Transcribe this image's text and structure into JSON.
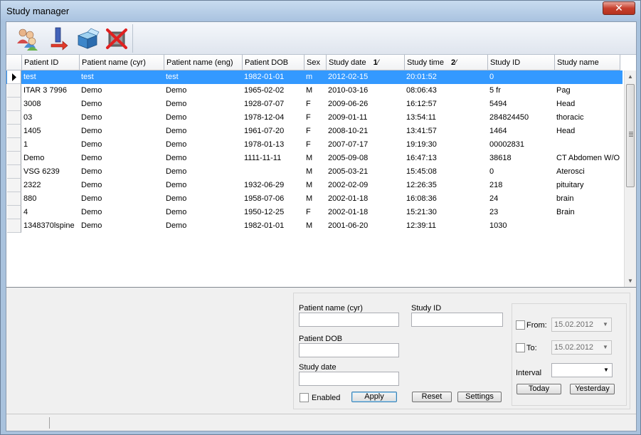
{
  "window": {
    "title": "Study manager",
    "close_label": "✕"
  },
  "toolbar": {
    "icons": [
      "patients-icon",
      "import-icon",
      "open-box-icon",
      "delete-icon"
    ]
  },
  "grid": {
    "columns": [
      "Patient ID",
      "Patient name (cyr)",
      "Patient name (eng)",
      "Patient DOB",
      "Sex",
      "Study date",
      "Study time",
      "Study ID",
      "Study name"
    ],
    "sort_markers": {
      "study_date": "1",
      "study_time": "2"
    },
    "selected_row": 0,
    "rows": [
      [
        "test",
        "test",
        "test",
        "1982-01-01",
        "m",
        "2012-02-15",
        "20:01:52",
        "0",
        ""
      ],
      [
        "ITAR 3    7996",
        "Demo",
        "Demo",
        "1965-02-02",
        "M",
        "2010-03-16",
        "08:06:43",
        "5 fr",
        "Pag"
      ],
      [
        "3008",
        "Demo",
        "Demo",
        "1928-07-07",
        "F",
        "2009-06-26",
        "16:12:57",
        "5494",
        "Head"
      ],
      [
        "03",
        "Demo",
        "Demo",
        "1978-12-04",
        "F",
        "2009-01-11",
        "13:54:11",
        "284824450",
        "thoracic"
      ],
      [
        "1405",
        "Demo",
        "Demo",
        "1961-07-20",
        "F",
        "2008-10-21",
        "13:41:57",
        "1464",
        "Head"
      ],
      [
        "1",
        "Demo",
        "Demo",
        "1978-01-13",
        "F",
        "2007-07-17",
        "19:19:30",
        "00002831",
        ""
      ],
      [
        "Demo",
        "Demo",
        "Demo",
        "1111-11-11",
        "M",
        "2005-09-08",
        "16:47:13",
        "38618",
        "CT Abdomen W/O c"
      ],
      [
        "VSG    6239",
        "Demo",
        "Demo",
        "",
        "M",
        "2005-03-21",
        "15:45:08",
        "0",
        "Aterosci"
      ],
      [
        "2322",
        "Demo",
        "Demo",
        "1932-06-29",
        "M",
        "2002-02-09",
        "12:26:35",
        "218",
        "pituitary"
      ],
      [
        "880",
        "Demo",
        "Demo",
        "1958-07-06",
        "M",
        "2002-01-18",
        "16:08:36",
        "24",
        "brain"
      ],
      [
        "4",
        "Demo",
        "Demo",
        "1950-12-25",
        "F",
        "2002-01-18",
        "15:21:30",
        "23",
        "Brain"
      ],
      [
        "1348370lspine",
        "Demo",
        "Demo",
        "1982-01-01",
        "M",
        "2001-06-20",
        "12:39:11",
        "1030",
        ""
      ]
    ]
  },
  "filter": {
    "patient_name_label": "Patient name (cyr)",
    "patient_name_value": "",
    "study_id_label": "Study ID",
    "study_id_value": "",
    "patient_dob_label": "Patient DOB",
    "patient_dob_value": "",
    "study_date_label": "Study date",
    "study_date_value": "",
    "enabled_label": "Enabled",
    "apply_label": "Apply",
    "reset_label": "Reset",
    "settings_label": "Settings",
    "from_label": "From:",
    "from_value": "15.02.2012",
    "to_label": "To:",
    "to_value": "15.02.2012",
    "interval_label": "Interval",
    "interval_value": "",
    "today_label": "Today",
    "yesterday_label": "Yesterday"
  },
  "colors": {
    "selection": "#3399ff",
    "title_bar": "#aac3e0"
  }
}
